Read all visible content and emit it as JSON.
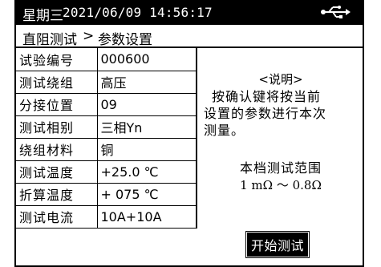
{
  "status": {
    "day": "星期三",
    "datetime": "2021/06/09 14:56:17",
    "usb_icon": "usb-icon"
  },
  "breadcrumb": {
    "parent": "直阻测试",
    "separator": ">",
    "current": "参数设置"
  },
  "params": [
    {
      "label": "试验编号",
      "value": "000600"
    },
    {
      "label": "测试绕组",
      "value": "高压"
    },
    {
      "label": "分接位置",
      "value": "09"
    },
    {
      "label": "测试相别",
      "value": "三相Yn"
    },
    {
      "label": "绕组材料",
      "value": "铜"
    },
    {
      "label": "测试温度",
      "value": "+25.0 ℃"
    },
    {
      "label": "折算温度",
      "value": "+ 075 ℃"
    },
    {
      "label": "测试电流",
      "value": "10A+10A"
    }
  ],
  "note": {
    "title": "<说明>",
    "line1": "按确认键将按当前",
    "line2": "设置的参数进行本次",
    "line3": "测量。",
    "range_title": "本档测试范围",
    "range": "1 mΩ ～ 0.8Ω"
  },
  "start_button": "开始测试"
}
